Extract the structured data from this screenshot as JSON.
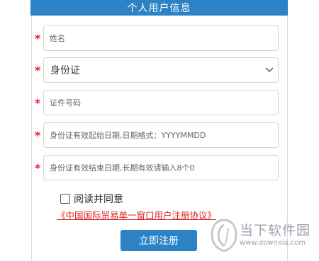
{
  "header": {
    "title": "个人用户信息"
  },
  "form": {
    "required_mark": "*",
    "name": {
      "placeholder": "姓名",
      "value": ""
    },
    "id_type": {
      "selected": "身份证"
    },
    "id_number": {
      "placeholder": "证件号码",
      "value": ""
    },
    "start_date": {
      "placeholder": "身份证有效起始日期,日期格式：YYYYMMDD",
      "value": ""
    },
    "end_date": {
      "placeholder": "身份证有效结束日期,长期有效请输入8个0",
      "value": ""
    }
  },
  "agreement": {
    "checkbox_label": "阅读并同意",
    "checked": false,
    "link_text": "《中国国际贸易单一窗口用户注册协议》"
  },
  "submit": {
    "label": "立即注册"
  },
  "watermark": {
    "name": "当下软件园",
    "url": "www.downxia.com"
  },
  "colors": {
    "primary": "#2b83c6",
    "required": "#e02020",
    "border": "#cfd6dc"
  },
  "icons": {
    "select_arrow": "chevron-down-icon",
    "watermark_logo": "downxia-logo-icon"
  }
}
